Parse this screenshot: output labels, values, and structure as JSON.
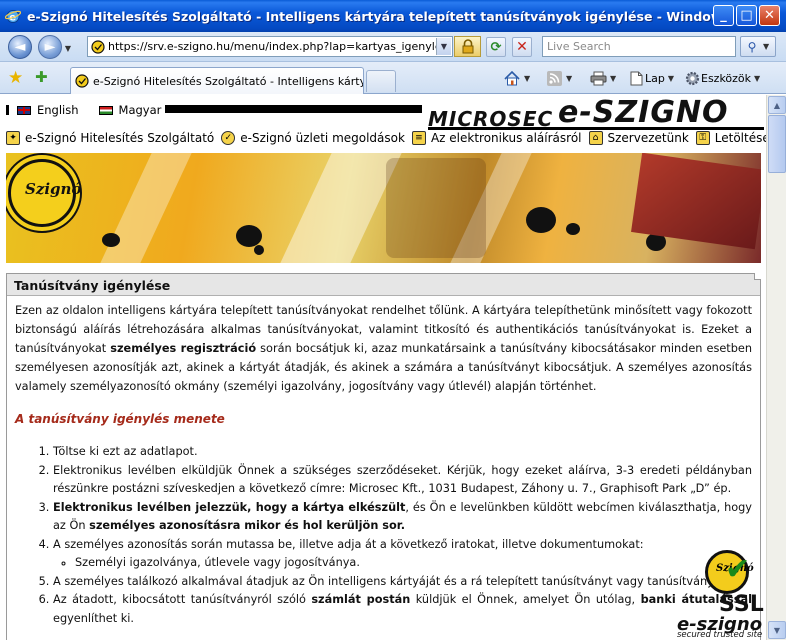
{
  "window": {
    "title": "e-Szignó Hitelesítés Szolgáltató - Intelligens kártyára telepített tanúsítványok igénylése - Windows Internet E...",
    "min_label": "_",
    "max_label": "□",
    "close_label": "✕"
  },
  "navbar": {
    "back_label": "◄",
    "forward_label": "►",
    "url": "https://srv.e-szigno.hu/menu/index.php?lap=kartyas_igenyles",
    "search_placeholder": "Live Search"
  },
  "tabs": {
    "active_label": "e-Szignó Hitelesítés Szolgáltató - Intelligens kártya t..."
  },
  "commands": {
    "page_label": "Lap",
    "tools_label": "Eszközök"
  },
  "languages": [
    {
      "label": "English"
    },
    {
      "label": "Magyar"
    }
  ],
  "logo": {
    "part1": "MICROSEC",
    "part2": "e-SZIGNO"
  },
  "menu": [
    {
      "label": "e-Szignó Hitelesítés Szolgáltató"
    },
    {
      "label": "e-Szignó üzleti megoldások"
    },
    {
      "label": "Az elektronikus aláírásról"
    },
    {
      "label": "Szervezetünk"
    },
    {
      "label": "Letöltések"
    }
  ],
  "banner": {
    "seal_text": "Szignó"
  },
  "panel": {
    "title": "Tanúsítvány igénylése",
    "intro_1": "Ezen az oldalon intelligens kártyára telepített tanúsítványokat rendelhet tőlünk. A kártyára telepíthetünk minősített vagy fokozott biztonságú aláírás létrehozására alkalmas tanúsítványokat, valamint titkosító és authentikációs tanúsítványokat is. Ezeket a tanúsítványokat ",
    "intro_bold": "személyes regisztráció",
    "intro_2": " során bocsátjuk ki, azaz munkatársaink a tanúsítvány kibocsátásakor minden esetben személyesen azonosítják azt, akinek a kártyát átadják, és akinek a számára a tanúsítványt kibocsátjuk. A személyes azonosítás valamely személyazonosító okmány (személyi igazolvány, jogosítvány vagy útlevél) alapján történhet.",
    "section_title": "A tanúsítvány igénylés menete",
    "steps": {
      "s1": "Töltse ki ezt az adatlapot.",
      "s2": "Elektronikus levélben elküldjük Önnek a szükséges szerződéseket. Kérjük, hogy ezeket aláírva, 3-3 eredeti példányban részünkre postázni szíveskedjen a következő címre: Microsec Kft., 1031 Budapest, Záhony u. 7., Graphisoft Park „D” ép.",
      "s3_bold1": "Elektronikus levélben jelezzük, hogy a kártya elkészült",
      "s3_mid": ", és Ön e levelünkben küldött webcímen kiválaszthatja, hogy az Ön ",
      "s3_bold2": "személyes azonosításra mikor és hol kerüljön sor.",
      "s4": "A személyes azonosítás során mutassa be, illetve adja át a következő iratokat, illetve dokumentumokat:",
      "s4_sub": "Személyi igazolványa, útlevele vagy jogosítványa.",
      "s5": "A személyes találkozó alkalmával átadjuk az Ön intelligens kártyáját és a rá telepített tanúsítványt vagy tanúsítványokat.",
      "s6_a": "Az átadott, kibocsátott tanúsítványról szóló ",
      "s6_bold": "számlát postán",
      "s6_b": " küldjük el Önnek, amelyet Ön utólag, ",
      "s6_bold2": "banki átutalással",
      "s6_c": " egyenlíthet ki."
    }
  },
  "ssl_badge": {
    "seal": "Szignó",
    "ssl": "SSL",
    "brand": "e-szigno",
    "tagline": "secured trusted site"
  },
  "colors": {
    "titlebar": "#0a58d8",
    "section_heading": "#a52a1a",
    "panel_header_bg": "#e6e6e6"
  }
}
